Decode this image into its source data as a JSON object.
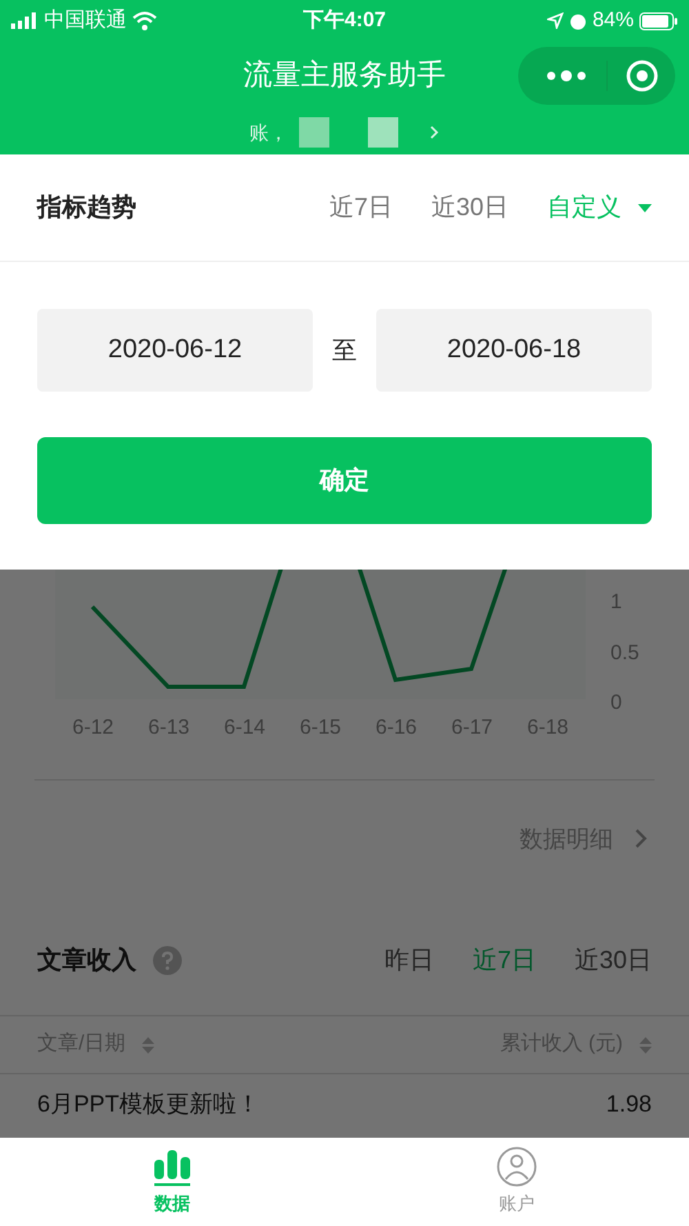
{
  "status_bar": {
    "carrier": "中国联通",
    "time": "下午4:07",
    "battery": "84%"
  },
  "nav": {
    "title": "流量主服务助手",
    "subtitle": "账，"
  },
  "trend": {
    "title": "指标趋势",
    "ranges": [
      {
        "label": "近7日",
        "selected": false,
        "kind": "plain"
      },
      {
        "label": "近30日",
        "selected": false,
        "kind": "plain"
      },
      {
        "label": "自定义",
        "selected": true,
        "kind": "dropdown"
      }
    ]
  },
  "date_range": {
    "start": "2020-06-12",
    "separator": "至",
    "end": "2020-06-18",
    "confirm": "确定"
  },
  "chart": {
    "x_labels": [
      "6-12",
      "6-13",
      "6-14",
      "6-15",
      "6-16",
      "6-17",
      "6-18"
    ],
    "y_labels": [
      "1",
      "0.5",
      "0"
    ]
  },
  "detail_link": "数据明细",
  "income": {
    "title": "文章收入",
    "ranges": [
      {
        "label": "昨日",
        "selected": false
      },
      {
        "label": "近7日",
        "selected": true
      },
      {
        "label": "近30日",
        "selected": false
      }
    ],
    "columns": [
      "文章/日期",
      "累计收入 (元)"
    ],
    "rows": [
      {
        "title": "6月PPT模板更新啦！",
        "amount": "1.98"
      }
    ]
  },
  "tab_bar": [
    {
      "label": "数据",
      "selected": true,
      "kind": "chart"
    },
    {
      "label": "账户",
      "selected": false,
      "kind": "person"
    }
  ]
}
